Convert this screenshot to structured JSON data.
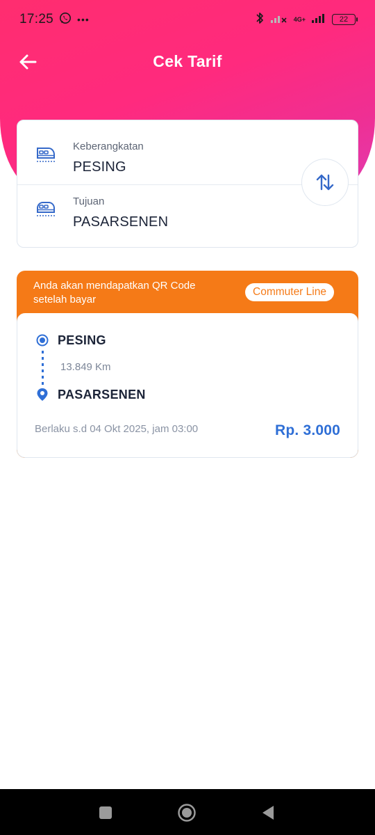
{
  "status_bar": {
    "time": "17:25",
    "overflow": "•••",
    "network_label": "4G+",
    "battery": "22"
  },
  "app_bar": {
    "title": "Cek Tarif"
  },
  "route_form": {
    "departure": {
      "label": "Keberangkatan",
      "value": "PESING"
    },
    "destination": {
      "label": "Tujuan",
      "value": "PASARSENEN"
    }
  },
  "fare_result": {
    "banner_line1": "Anda akan mendapatkan QR Code",
    "banner_line2": "setelah bayar",
    "service_badge": "Commuter Line",
    "origin": "PESING",
    "distance": "13.849 Km",
    "destination": "PASARSENEN",
    "validity": "Berlaku s.d 04 Okt 2025, jam 03:00",
    "price": "Rp. 3.000"
  },
  "icons": {
    "back": "arrow-left-icon",
    "swap": "swap-vertical-icon",
    "departure": "train-icon",
    "destination": "train-icon",
    "origin_marker": "origin-dot-icon",
    "destination_marker": "location-pin-icon",
    "nav": [
      "recents-square-icon",
      "home-circle-icon",
      "back-triangle-icon"
    ]
  },
  "colors": {
    "header_gradient_start": "#ff2d6f",
    "header_gradient_end": "#e23bb0",
    "accent_orange": "#f57a17",
    "accent_blue": "#2f6fd6",
    "text_dark": "#1c2438",
    "text_muted": "#8a93a4"
  }
}
